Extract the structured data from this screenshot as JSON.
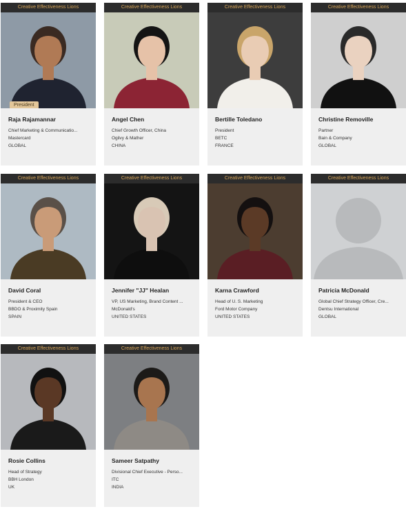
{
  "banner_label": "Creative Effectiveness Lions",
  "badge_label": "President",
  "jurors": [
    {
      "name": "Raja Rajamannar",
      "title": "Chief Marketing & Communicatio...",
      "company": "Mastercard",
      "region": "GLOBAL",
      "badge": true
    },
    {
      "name": "Angel Chen",
      "title": "Chief Growth Officer, China",
      "company": "Ogilvy & Mather",
      "region": "CHINA"
    },
    {
      "name": "Bertille Toledano",
      "title": "President",
      "company": "BETC",
      "region": "FRANCE"
    },
    {
      "name": "Christine Removille",
      "title": "Partner",
      "company": "Bain & Company",
      "region": "GLOBAL"
    },
    {
      "name": "David Coral",
      "title": "President & CEO",
      "company": "BBDO & Proximity Spain",
      "region": "SPAIN"
    },
    {
      "name": "Jennifer \"JJ\" Healan",
      "title": "VP, US Marketing, Brand Content ...",
      "company": "McDonald's",
      "region": "UNITED STATES"
    },
    {
      "name": "Karna Crawford",
      "title": "Head of U. S. Marketing",
      "company": "Ford Motor Company",
      "region": "UNITED STATES"
    },
    {
      "name": "Patricia McDonald",
      "title": "Global Chief Strategy Officer, Cre...",
      "company": "Dentsu International",
      "region": "GLOBAL"
    },
    {
      "name": "Rosie Collins",
      "title": "Head of Strategy",
      "company": "BBH London",
      "region": "UK"
    },
    {
      "name": "Sameer Satpathy",
      "title": "Divisional Chief Executive - Perso...",
      "company": "ITC",
      "region": "INDIA"
    }
  ],
  "photo_styles": [
    {
      "bg": "#8e9aa6",
      "skin": "#b07a55",
      "hair": "#3a2a22",
      "shirt": "#1f2330"
    },
    {
      "bg": "#c8cbb8",
      "skin": "#e6c2a8",
      "hair": "#141414",
      "shirt": "#8c2434"
    },
    {
      "bg": "#3d3d3d",
      "skin": "#e9ccb4",
      "hair": "#c9a56a",
      "shirt": "#f1efea"
    },
    {
      "bg": "#cfcfcf",
      "skin": "#ead2c0",
      "hair": "#2a2a2a",
      "shirt": "#111111"
    },
    {
      "bg": "#aebac3",
      "skin": "#c99b78",
      "hair": "#5a5048",
      "shirt": "#4a3b24"
    },
    {
      "bg": "#141414",
      "skin": "#d9c3b2",
      "hair": "#d8cab7",
      "shirt": "#0e0e0e"
    },
    {
      "bg": "#4c3d30",
      "skin": "#5b3a26",
      "hair": "#141010",
      "shirt": "#5a1e24"
    },
    {
      "bg": "#cfd1d3",
      "skin": "#b8babc",
      "hair": "#b8babc",
      "shirt": "#b8babc"
    },
    {
      "bg": "#b7b9bd",
      "skin": "#5a3825",
      "hair": "#111111",
      "shirt": "#1a1a1a"
    },
    {
      "bg": "#7d7f82",
      "skin": "#a8754f",
      "hair": "#1c1a18",
      "shirt": "#8e8a85"
    }
  ]
}
